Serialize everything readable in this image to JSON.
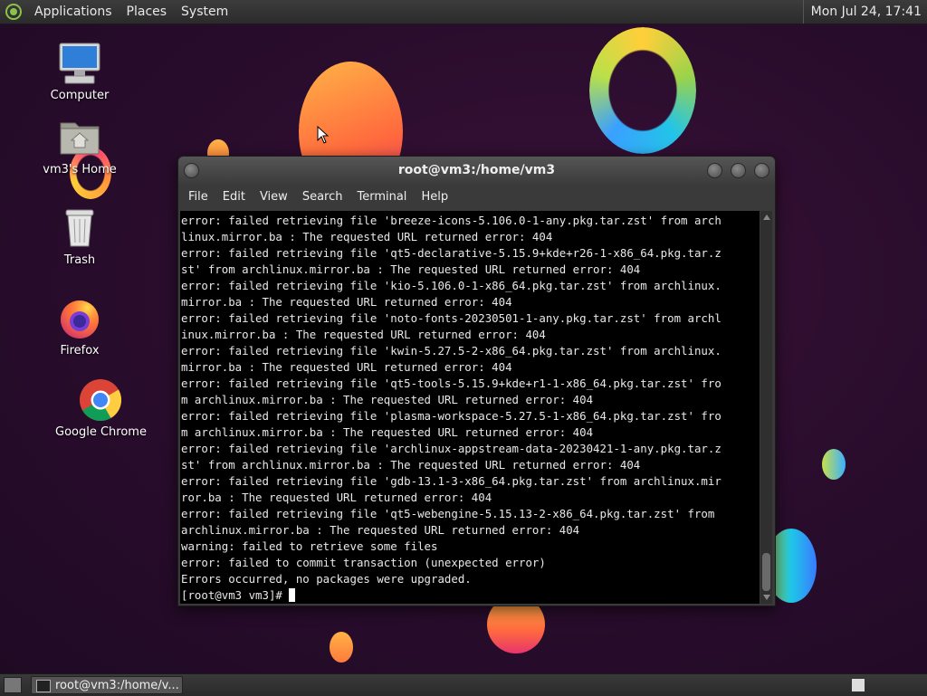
{
  "top_panel": {
    "menus": [
      "Applications",
      "Places",
      "System"
    ],
    "clock": "Mon Jul 24, 17:41"
  },
  "desktop_icons": [
    {
      "label": "Computer",
      "icon": "computer-icon"
    },
    {
      "label": "vm3's Home",
      "icon": "home-folder-icon"
    },
    {
      "label": "Trash",
      "icon": "trash-icon"
    },
    {
      "label": "Firefox",
      "icon": "firefox-icon"
    },
    {
      "label": "Google Chrome",
      "icon": "chrome-icon"
    }
  ],
  "terminal": {
    "title": "root@vm3:/home/vm3",
    "menu": [
      "File",
      "Edit",
      "View",
      "Search",
      "Terminal",
      "Help"
    ],
    "lines": [
      "error: failed retrieving file 'breeze-icons-5.106.0-1-any.pkg.tar.zst' from arch",
      "linux.mirror.ba : The requested URL returned error: 404",
      "error: failed retrieving file 'qt5-declarative-5.15.9+kde+r26-1-x86_64.pkg.tar.z",
      "st' from archlinux.mirror.ba : The requested URL returned error: 404",
      "error: failed retrieving file 'kio-5.106.0-1-x86_64.pkg.tar.zst' from archlinux.",
      "mirror.ba : The requested URL returned error: 404",
      "error: failed retrieving file 'noto-fonts-20230501-1-any.pkg.tar.zst' from archl",
      "inux.mirror.ba : The requested URL returned error: 404",
      "error: failed retrieving file 'kwin-5.27.5-2-x86_64.pkg.tar.zst' from archlinux.",
      "mirror.ba : The requested URL returned error: 404",
      "error: failed retrieving file 'qt5-tools-5.15.9+kde+r1-1-x86_64.pkg.tar.zst' fro",
      "m archlinux.mirror.ba : The requested URL returned error: 404",
      "error: failed retrieving file 'plasma-workspace-5.27.5-1-x86_64.pkg.tar.zst' fro",
      "m archlinux.mirror.ba : The requested URL returned error: 404",
      "error: failed retrieving file 'archlinux-appstream-data-20230421-1-any.pkg.tar.z",
      "st' from archlinux.mirror.ba : The requested URL returned error: 404",
      "error: failed retrieving file 'gdb-13.1-3-x86_64.pkg.tar.zst' from archlinux.mir",
      "ror.ba : The requested URL returned error: 404",
      "error: failed retrieving file 'qt5-webengine-5.15.13-2-x86_64.pkg.tar.zst' from",
      "archlinux.mirror.ba : The requested URL returned error: 404",
      "warning: failed to retrieve some files",
      "error: failed to commit transaction (unexpected error)",
      "Errors occurred, no packages were upgraded."
    ],
    "prompt": "[root@vm3 vm3]# "
  },
  "taskbar": {
    "task_label": "root@vm3:/home/v..."
  }
}
